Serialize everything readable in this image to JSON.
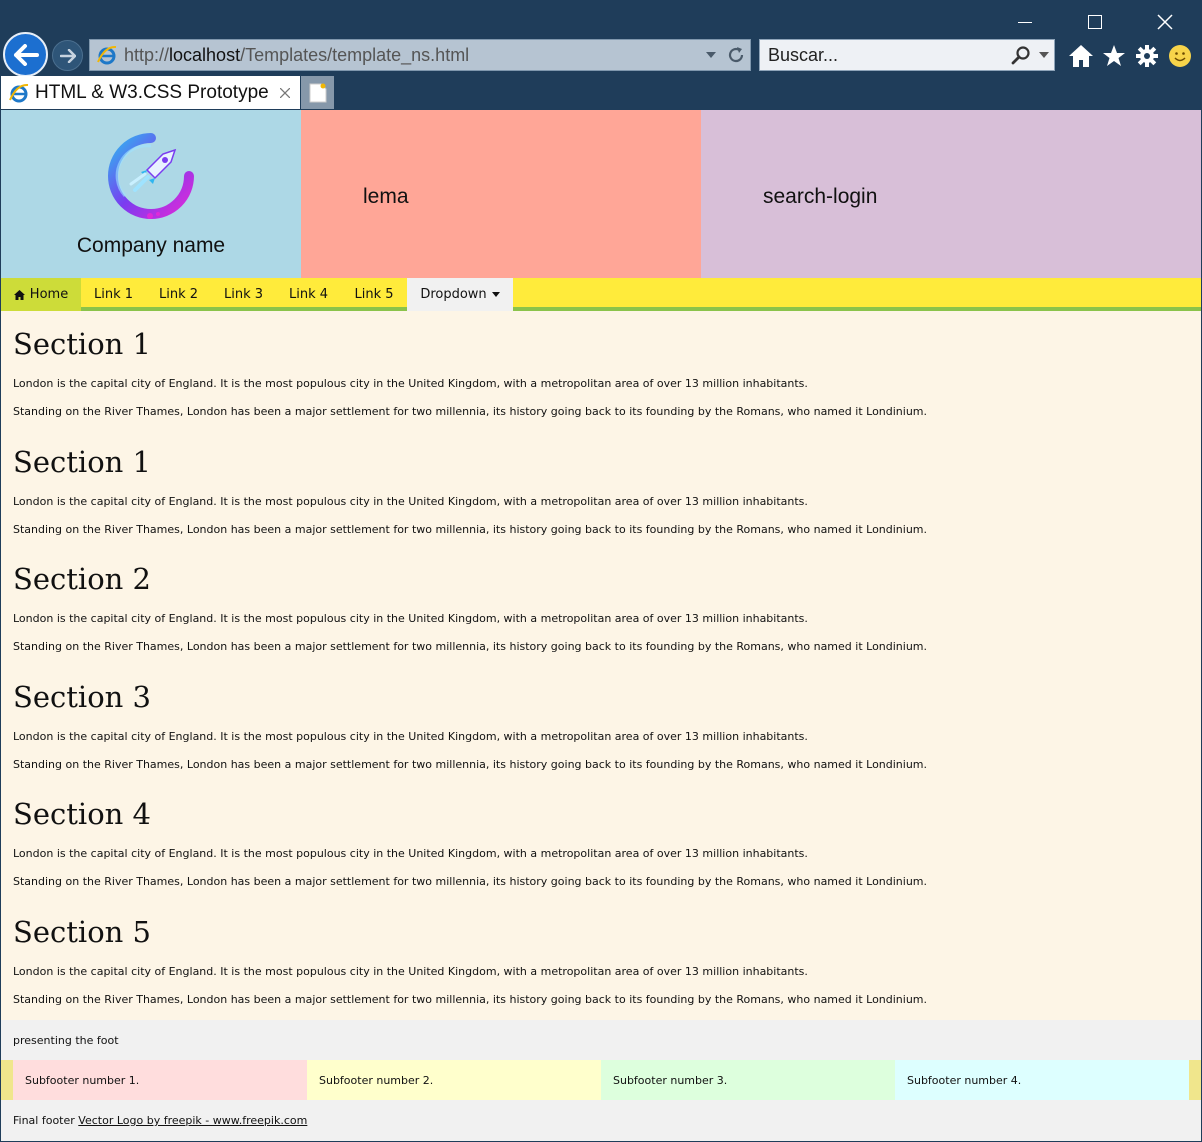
{
  "browser": {
    "address": {
      "protocol": "http://",
      "host": "localhost",
      "path": "/Templates/template_ns.html"
    },
    "search_placeholder": "Buscar...",
    "tab_title": "HTML & W3.CSS Prototype",
    "icons": [
      "back-icon",
      "forward-icon",
      "ie-icon",
      "refresh-icon",
      "search-icon",
      "home-icon",
      "star-icon",
      "gear-icon",
      "smiley-icon",
      "close-icon",
      "new-tab-icon"
    ]
  },
  "header": {
    "company_name": "Company name",
    "lema": "lema",
    "search_login": "search-login",
    "colors": {
      "logo_bg": "#add8e6",
      "lema_bg": "#ffa697",
      "search_bg": "#d8bfd8"
    }
  },
  "navbar": {
    "home": "Home",
    "links": [
      "Link 1",
      "Link 2",
      "Link 3",
      "Link 4",
      "Link 5"
    ],
    "dropdown": "Dropdown",
    "colors": {
      "bar": "#ffeb3b",
      "home": "#cddc39",
      "underline": "#8bc34a"
    }
  },
  "sections": [
    {
      "title": "Section 1",
      "p1": "London is the capital city of England. It is the most populous city in the United Kingdom, with a metropolitan area of over 13 million inhabitants.",
      "p2": "Standing on the River Thames, London has been a major settlement for two millennia, its history going back to its founding by the Romans, who named it Londinium."
    },
    {
      "title": "Section 1",
      "p1": "London is the capital city of England. It is the most populous city in the United Kingdom, with a metropolitan area of over 13 million inhabitants.",
      "p2": "Standing on the River Thames, London has been a major settlement for two millennia, its history going back to its founding by the Romans, who named it Londinium."
    },
    {
      "title": "Section 2",
      "p1": "London is the capital city of England. It is the most populous city in the United Kingdom, with a metropolitan area of over 13 million inhabitants.",
      "p2": "Standing on the River Thames, London has been a major settlement for two millennia, its history going back to its founding by the Romans, who named it Londinium."
    },
    {
      "title": "Section 3",
      "p1": "London is the capital city of England. It is the most populous city in the United Kingdom, with a metropolitan area of over 13 million inhabitants.",
      "p2": "Standing on the River Thames, London has been a major settlement for two millennia, its history going back to its founding by the Romans, who named it Londinium."
    },
    {
      "title": "Section 4",
      "p1": "London is the capital city of England. It is the most populous city in the United Kingdom, with a metropolitan area of over 13 million inhabitants.",
      "p2": "Standing on the River Thames, London has been a major settlement for two millennia, its history going back to its founding by the Romans, who named it Londinium."
    },
    {
      "title": "Section 5",
      "p1": "London is the capital city of England. It is the most populous city in the United Kingdom, with a metropolitan area of over 13 million inhabitants.",
      "p2": "Standing on the River Thames, London has been a major settlement for two millennia, its history going back to its founding by the Romans, who named it Londinium."
    }
  ],
  "footer": {
    "foot_text": "presenting the foot",
    "subfooters": [
      "Subfooter number 1.",
      "Subfooter number 2.",
      "Subfooter number 3.",
      "Subfooter number 4."
    ],
    "final_prefix": "Final footer",
    "final_link": "Vector Logo by freepik - www.freepik.com"
  }
}
